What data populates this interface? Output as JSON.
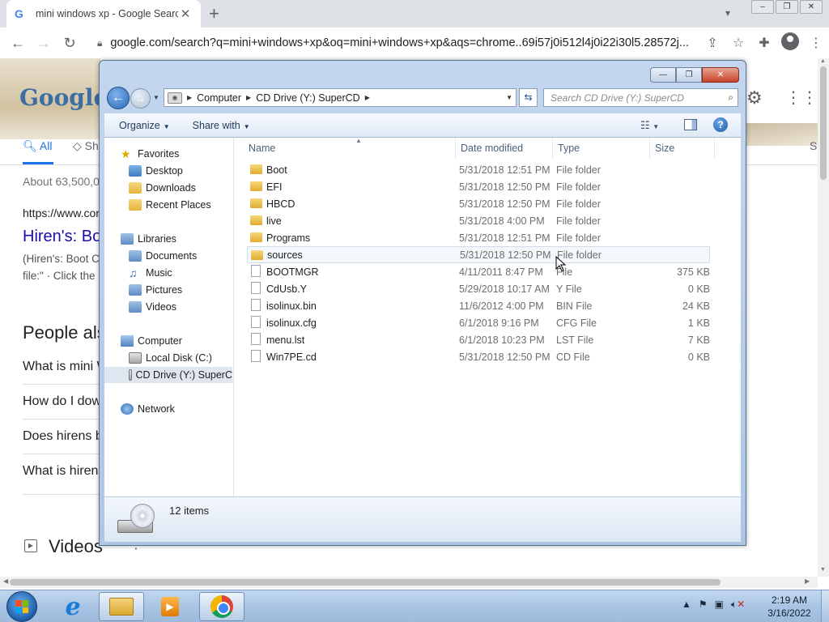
{
  "browser": {
    "tab_title": "mini windows xp - Google Search",
    "tab_favicon": "G",
    "url": "google.com/search?q=mini+windows+xp&oq=mini+windows+xp&aqs=chrome..69i57j0i512l4j0i22i30l5.28572j...",
    "new_tab_symbol": "+",
    "window_controls": [
      "–",
      "❐",
      "✕"
    ]
  },
  "google": {
    "logo_text": "Google",
    "tabs": {
      "all": "All",
      "shopping": "Sh",
      "right_cut": "S"
    },
    "stats": "About 63,500,0",
    "cite": "https://www.cor",
    "result_title": "Hiren's: Boo",
    "snippet_1": "(Hiren's: Boot C",
    "snippet_2": "file:\" · Click the",
    "people_also_ask": "People als",
    "questions": [
      "What is mini W",
      "How do I dow",
      "Does hirens b",
      "What is hiren"
    ],
    "videos_label": "Videos",
    "videos_more": "⋮"
  },
  "explorer": {
    "controls": {
      "minimize": "—",
      "maximize": "❐",
      "close": "✕"
    },
    "breadcrumb": [
      "Computer",
      "CD Drive (Y:) SuperCD"
    ],
    "search_placeholder": "Search CD Drive (Y:) SuperCD",
    "commands": {
      "organize": "Organize",
      "share_with": "Share with"
    },
    "help_symbol": "?",
    "nav": {
      "favorites": "Favorites",
      "desktop": "Desktop",
      "downloads": "Downloads",
      "recent_places": "Recent Places",
      "libraries": "Libraries",
      "documents": "Documents",
      "music": "Music",
      "pictures": "Pictures",
      "videos": "Videos",
      "computer": "Computer",
      "local_disk": "Local Disk (C:)",
      "cd_drive": "CD Drive (Y:) SuperC",
      "network": "Network"
    },
    "columns": {
      "name": "Name",
      "date": "Date modified",
      "type": "Type",
      "size": "Size"
    },
    "files": [
      {
        "name": "Boot",
        "date": "5/31/2018 12:51 PM",
        "type": "File folder",
        "size": "",
        "kind": "folder"
      },
      {
        "name": "EFI",
        "date": "5/31/2018 12:50 PM",
        "type": "File folder",
        "size": "",
        "kind": "folder"
      },
      {
        "name": "HBCD",
        "date": "5/31/2018 12:50 PM",
        "type": "File folder",
        "size": "",
        "kind": "folder"
      },
      {
        "name": "live",
        "date": "5/31/2018 4:00 PM",
        "type": "File folder",
        "size": "",
        "kind": "folder"
      },
      {
        "name": "Programs",
        "date": "5/31/2018 12:51 PM",
        "type": "File folder",
        "size": "",
        "kind": "folder"
      },
      {
        "name": "sources",
        "date": "5/31/2018 12:50 PM",
        "type": "File folder",
        "size": "",
        "kind": "folder"
      },
      {
        "name": "BOOTMGR",
        "date": "4/11/2011 8:47 PM",
        "type": "File",
        "size": "375 KB",
        "kind": "file"
      },
      {
        "name": "CdUsb.Y",
        "date": "5/29/2018 10:17 AM",
        "type": "Y File",
        "size": "0 KB",
        "kind": "file"
      },
      {
        "name": "isolinux.bin",
        "date": "11/6/2012 4:00 PM",
        "type": "BIN File",
        "size": "24 KB",
        "kind": "file"
      },
      {
        "name": "isolinux.cfg",
        "date": "6/1/2018 9:16 PM",
        "type": "CFG File",
        "size": "1 KB",
        "kind": "file"
      },
      {
        "name": "menu.lst",
        "date": "6/1/2018 10:23 PM",
        "type": "LST File",
        "size": "7 KB",
        "kind": "file"
      },
      {
        "name": "Win7PE.cd",
        "date": "5/31/2018 12:50 PM",
        "type": "CD File",
        "size": "0 KB",
        "kind": "file"
      }
    ],
    "status": "12 items"
  },
  "taskbar": {
    "time": "2:19 AM",
    "date": "3/16/2022"
  },
  "icons": {
    "back": "back-arrow-icon",
    "forward": "forward-arrow-icon",
    "refresh": "refresh-icon",
    "search": "search-icon",
    "folder": "folder-icon",
    "file": "file-icon"
  }
}
